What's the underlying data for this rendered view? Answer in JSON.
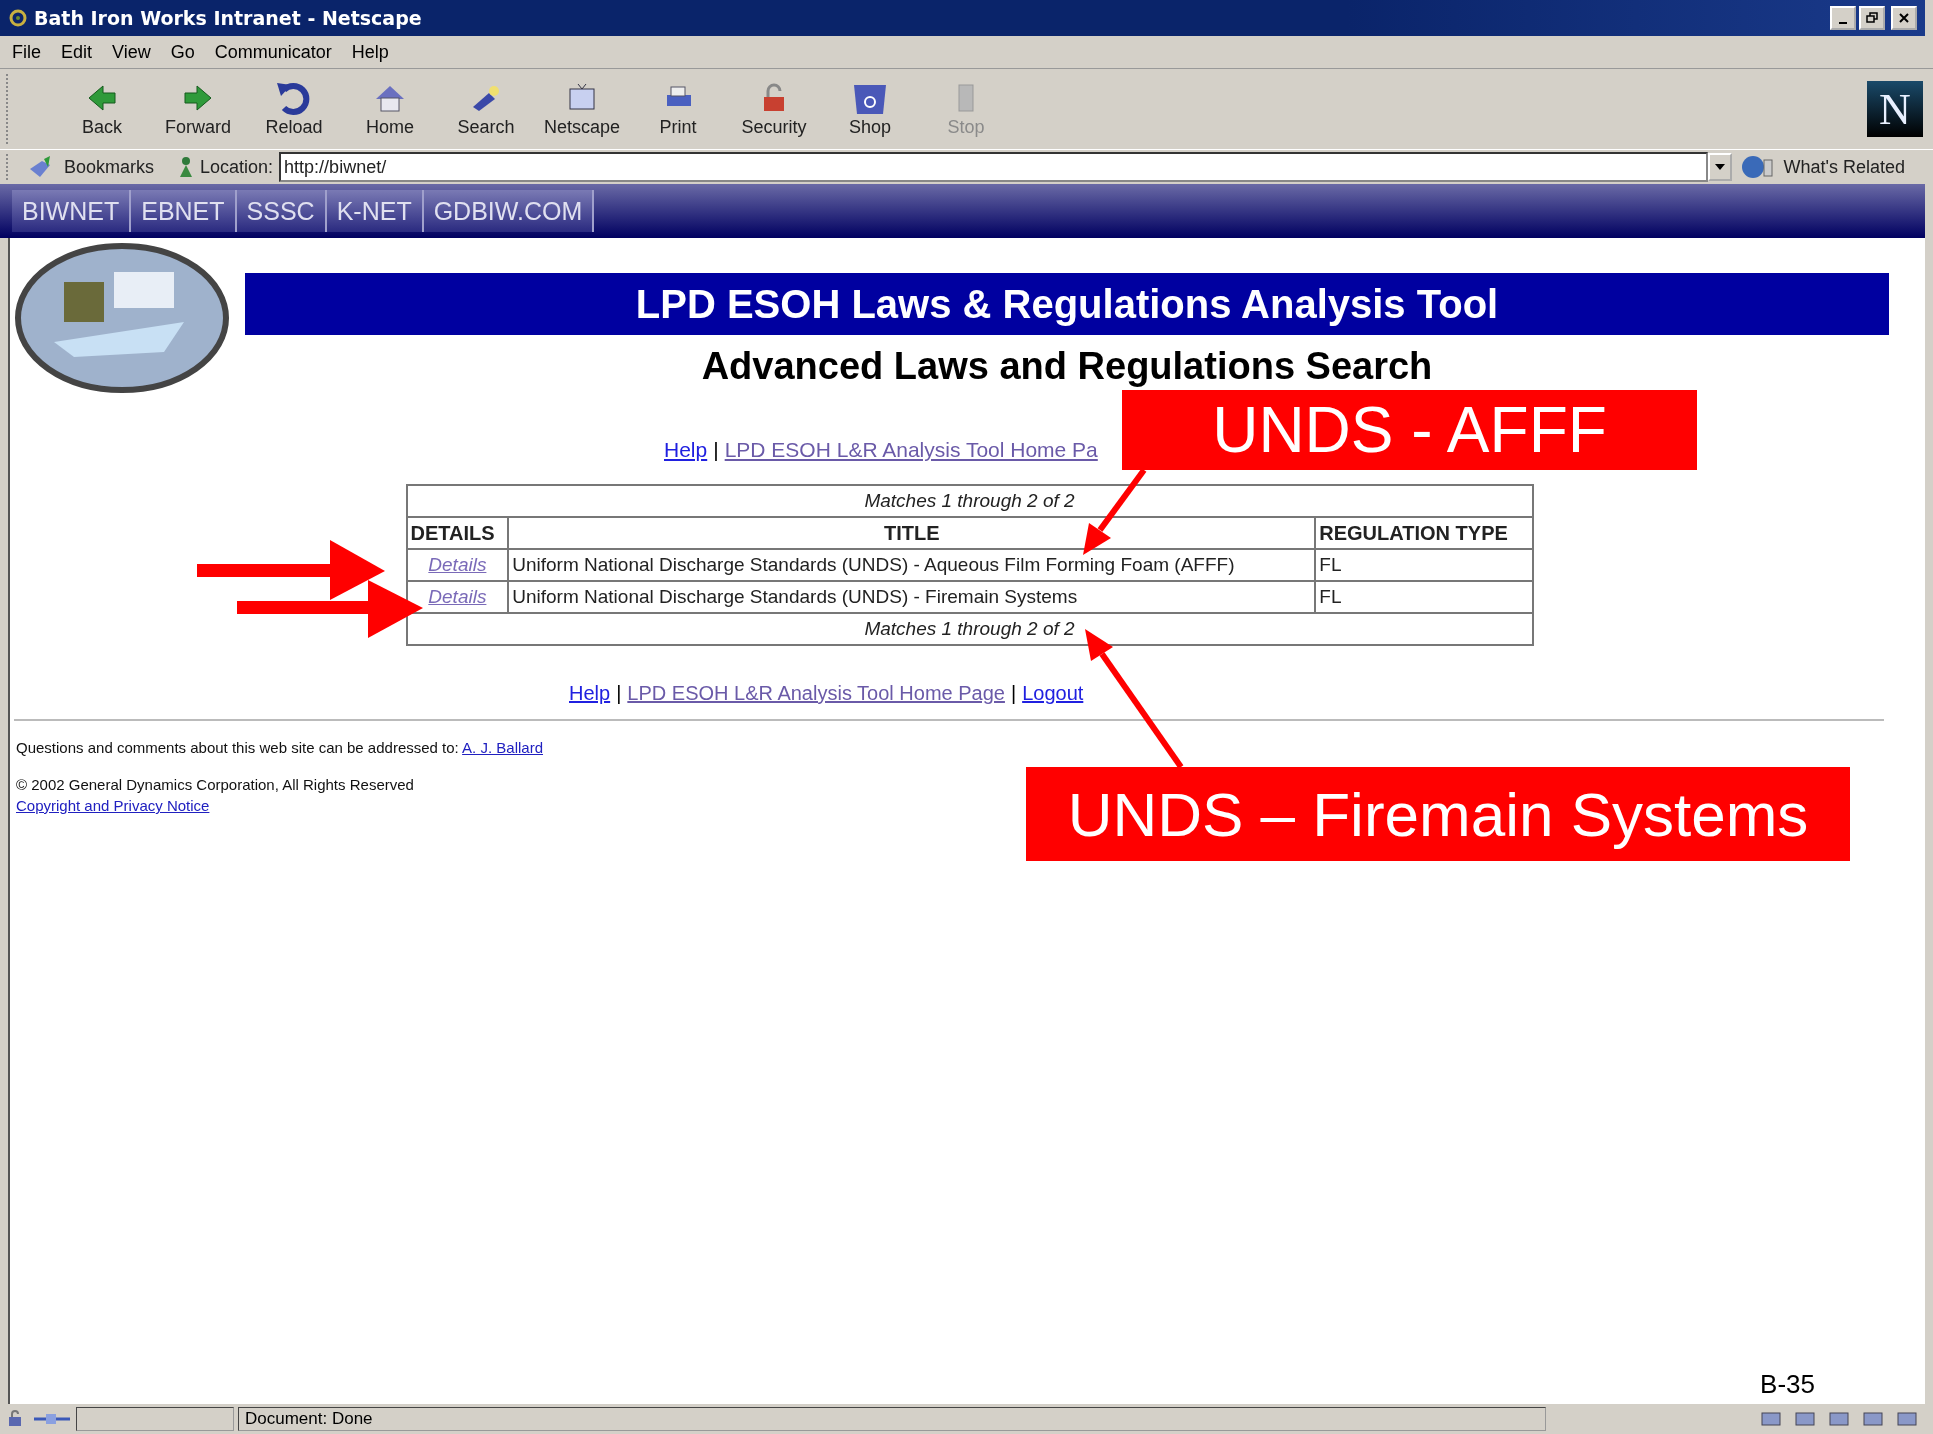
{
  "window": {
    "title": "Bath Iron Works Intranet - Netscape"
  },
  "menu": [
    "File",
    "Edit",
    "View",
    "Go",
    "Communicator",
    "Help"
  ],
  "toolbar": {
    "buttons": [
      {
        "label": "Back",
        "disabled": false
      },
      {
        "label": "Forward",
        "disabled": false
      },
      {
        "label": "Reload",
        "disabled": false
      },
      {
        "label": "Home",
        "disabled": false
      },
      {
        "label": "Search",
        "disabled": false
      },
      {
        "label": "Netscape",
        "disabled": false
      },
      {
        "label": "Print",
        "disabled": false
      },
      {
        "label": "Security",
        "disabled": false
      },
      {
        "label": "Shop",
        "disabled": false
      },
      {
        "label": "Stop",
        "disabled": true
      }
    ],
    "logo_letter": "N"
  },
  "location_bar": {
    "bookmarks": "Bookmarks",
    "label": "Location:",
    "url": "http://biwnet/",
    "related": "What's Related"
  },
  "site_tabs": [
    "BIWNET",
    "EBNET",
    "SSSC",
    "K-NET",
    "GDBIW.COM"
  ],
  "page": {
    "banner": "LPD ESOH Laws & Regulations Analysis Tool",
    "subtitle": "Advanced Laws and Regulations Search",
    "link_separator": "|",
    "top_links": [
      "Help",
      "LPD ESOH L&R Analysis Tool Home Pa"
    ],
    "table": {
      "summary_top": "Matches 1 through 2 of 2",
      "columns": [
        "DETAILS",
        "TITLE",
        "REGULATION TYPE"
      ],
      "rows": [
        {
          "details": "Details",
          "title": "Uniform National Discharge Standards (UNDS) - Aqueous Film Forming Foam (AFFF)",
          "type": "FL"
        },
        {
          "details": "Details",
          "title": "Uniform National Discharge Standards (UNDS) - Firemain Systems",
          "type": "FL"
        }
      ],
      "summary_bottom": "Matches 1 through 2 of 2"
    },
    "bottom_links": [
      "Help",
      "LPD ESOH L&R Analysis Tool Home Page",
      "Logout"
    ],
    "contact": {
      "text": "Questions and comments about this web site can be addressed to:",
      "link": "A. J. Ballard"
    },
    "copyright": "© 2002 General Dynamics Corporation, All Rights Reserved",
    "privacy_link": "Copyright and Privacy Notice"
  },
  "status_bar": {
    "text": "Document: Done"
  },
  "callouts": [
    "UNDS - AFFF",
    "UNDS – Firemain Systems"
  ],
  "page_number": "B-35"
}
